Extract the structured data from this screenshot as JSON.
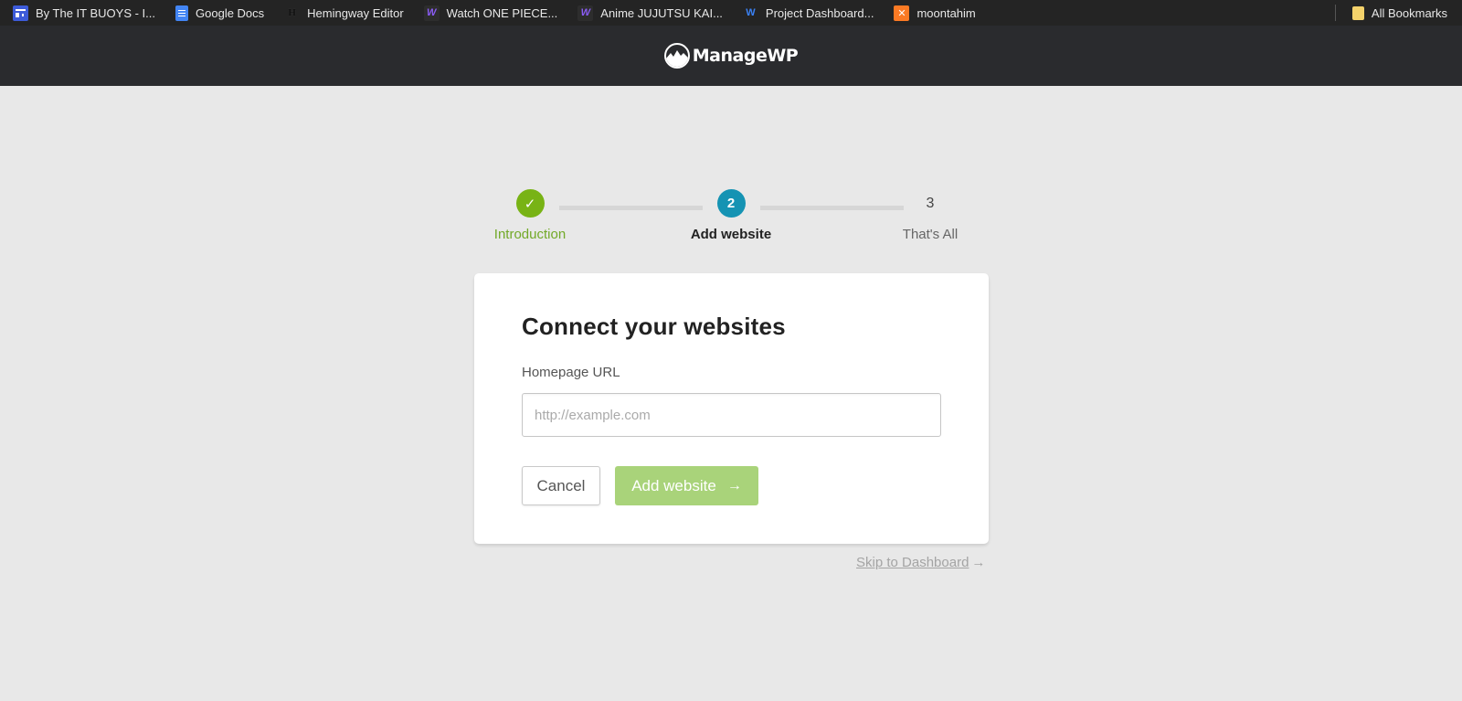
{
  "bookmarks": {
    "items": [
      {
        "label": "By The IT BUOYS - I...",
        "icon": "itbuoys-icon"
      },
      {
        "label": "Google Docs",
        "icon": "google-docs-icon"
      },
      {
        "label": "Hemingway Editor",
        "icon": "hemingway-icon"
      },
      {
        "label": "Watch ONE PIECE...",
        "icon": "w-purple-icon"
      },
      {
        "label": "Anime JUJUTSU KAI...",
        "icon": "w-purple-icon"
      },
      {
        "label": "Project Dashboard...",
        "icon": "w-blue-icon"
      },
      {
        "label": "moontahim",
        "icon": "xampp-icon"
      }
    ],
    "all_bookmarks_label": "All Bookmarks",
    "icon_glyphs": {
      "hemingway": "H",
      "w": "W",
      "xampp": "✕"
    }
  },
  "header": {
    "logo_text": "ManageWP"
  },
  "stepper": {
    "steps": [
      {
        "number": "✓",
        "label": "Introduction",
        "state": "complete"
      },
      {
        "number": "2",
        "label": "Add website",
        "state": "active"
      },
      {
        "number": "3",
        "label": "That's All",
        "state": "pending"
      }
    ]
  },
  "card": {
    "title": "Connect your websites",
    "field_label": "Homepage URL",
    "url_input": {
      "value": "",
      "placeholder": "http://example.com"
    },
    "cancel_label": "Cancel",
    "add_label": "Add website",
    "add_arrow": "→"
  },
  "skip": {
    "label": "Skip to Dashboard",
    "arrow": "→"
  },
  "colors": {
    "complete": "#78b315",
    "active": "#1593b3",
    "add_button": "#a9d37a",
    "header_bg": "#2a2b2e",
    "page_bg": "#e8e8e8"
  }
}
